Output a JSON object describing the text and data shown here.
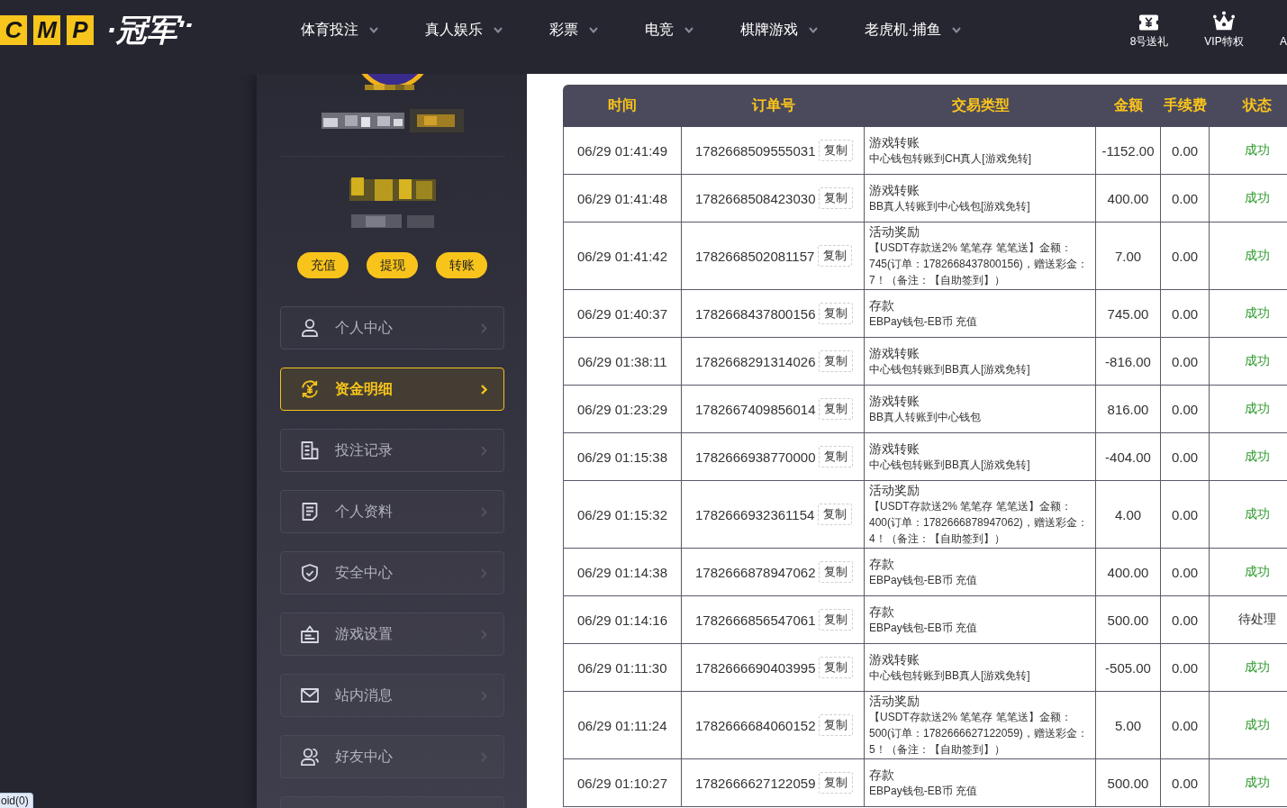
{
  "header": {
    "logo": {
      "tiles": [
        "C",
        "M",
        "P"
      ],
      "text": "·冠军"
    },
    "nav": [
      "体育投注",
      "真人娱乐",
      "彩票",
      "电竞",
      "棋牌游戏",
      "老虎机·捕鱼"
    ],
    "shortcuts": [
      {
        "label": "8号送礼",
        "kind": "ticket"
      },
      {
        "label": "VIP特权",
        "kind": "crown"
      },
      {
        "label": "A"
      }
    ]
  },
  "sidebar": {
    "actions": [
      "充值",
      "提现",
      "转账"
    ],
    "menu": [
      {
        "label": "个人中心",
        "kind": "user",
        "selected": false
      },
      {
        "label": "资金明细",
        "kind": "yen",
        "selected": true
      },
      {
        "label": "投注记录",
        "kind": "bets",
        "selected": false
      },
      {
        "label": "个人资料",
        "kind": "notepad",
        "selected": false
      },
      {
        "label": "安全中心",
        "kind": "shield",
        "selected": false
      },
      {
        "label": "游戏设置",
        "kind": "card",
        "selected": false
      },
      {
        "label": "站内消息",
        "kind": "mail",
        "selected": false
      },
      {
        "label": "好友中心",
        "kind": "friends",
        "selected": false
      },
      {
        "selected": false
      }
    ]
  },
  "table": {
    "columns": [
      "时间",
      "订单号",
      "交易类型",
      "金额",
      "手续费",
      "状态"
    ],
    "rows": [
      {
        "time": "06/29 01:41:49",
        "order_no": "1782668509555031",
        "copy": "复制",
        "type": "游戏转账",
        "detail": "中心钱包转账到CH真人[游戏免转]",
        "amount": "-1152.00",
        "fee": "0.00",
        "status": "成功",
        "kind": "success"
      },
      {
        "time": "06/29 01:41:48",
        "order_no": "1782668508423030",
        "copy": "复制",
        "type": "游戏转账",
        "detail": "BB真人转账到中心钱包[游戏免转]",
        "amount": "400.00",
        "fee": "0.00",
        "status": "成功",
        "kind": "success"
      },
      {
        "time": "06/29 01:41:42",
        "order_no": "1782668502081157",
        "copy": "复制",
        "type": "活动奖励",
        "detail": "【USDT存款送2% 笔笔存 笔笔送】金额：745(订单：1782668437800156)，赠送彩金：7！（备注：【自助签到】）",
        "amount": "7.00",
        "fee": "0.00",
        "status": "成功",
        "kind": "success"
      },
      {
        "time": "06/29 01:40:37",
        "order_no": "1782668437800156",
        "copy": "复制",
        "type": "存款",
        "detail": "EBPay钱包-EB币 充值",
        "amount": "745.00",
        "fee": "0.00",
        "status": "成功",
        "kind": "success"
      },
      {
        "time": "06/29 01:38:11",
        "order_no": "1782668291314026",
        "copy": "复制",
        "type": "游戏转账",
        "detail": "中心钱包转账到BB真人[游戏免转]",
        "amount": "-816.00",
        "fee": "0.00",
        "status": "成功",
        "kind": "success"
      },
      {
        "time": "06/29 01:23:29",
        "order_no": "1782667409856014",
        "copy": "复制",
        "type": "游戏转账",
        "detail": "BB真人转账到中心钱包",
        "amount": "816.00",
        "fee": "0.00",
        "status": "成功",
        "kind": "success"
      },
      {
        "time": "06/29 01:15:38",
        "order_no": "1782666938770000",
        "copy": "复制",
        "type": "游戏转账",
        "detail": "中心钱包转账到BB真人[游戏免转]",
        "amount": "-404.00",
        "fee": "0.00",
        "status": "成功",
        "kind": "success"
      },
      {
        "time": "06/29 01:15:32",
        "order_no": "1782666932361154",
        "copy": "复制",
        "type": "活动奖励",
        "detail": "【USDT存款送2% 笔笔存 笔笔送】金额：400(订单：1782666878947062)，赠送彩金：4！（备注：【自助签到】）",
        "amount": "4.00",
        "fee": "0.00",
        "status": "成功",
        "kind": "success"
      },
      {
        "time": "06/29 01:14:38",
        "order_no": "1782666878947062",
        "copy": "复制",
        "type": "存款",
        "detail": "EBPay钱包-EB币 充值",
        "amount": "400.00",
        "fee": "0.00",
        "status": "成功",
        "kind": "success"
      },
      {
        "time": "06/29 01:14:16",
        "order_no": "1782666856547061",
        "copy": "复制",
        "type": "存款",
        "detail": "EBPay钱包-EB币 充值",
        "amount": "500.00",
        "fee": "0.00",
        "status": "待处理",
        "kind": "pending"
      },
      {
        "time": "06/29 01:11:30",
        "order_no": "1782666690403995",
        "copy": "复制",
        "type": "游戏转账",
        "detail": "中心钱包转账到BB真人[游戏免转]",
        "amount": "-505.00",
        "fee": "0.00",
        "status": "成功",
        "kind": "success"
      },
      {
        "time": "06/29 01:11:24",
        "order_no": "1782666684060152",
        "copy": "复制",
        "type": "活动奖励",
        "detail": "【USDT存款送2% 笔笔存 笔笔送】金额：500(订单：1782666627122059)，赠送彩金：5！（备注：【自助签到】）",
        "amount": "5.00",
        "fee": "0.00",
        "status": "成功",
        "kind": "success"
      },
      {
        "time": "06/29 01:10:27",
        "order_no": "1782666627122059",
        "copy": "复制",
        "type": "存款",
        "detail": "EBPay钱包-EB币 充值",
        "amount": "500.00",
        "fee": "0.00",
        "status": "成功",
        "kind": "success"
      }
    ]
  },
  "status_bar": "oid(0)"
}
